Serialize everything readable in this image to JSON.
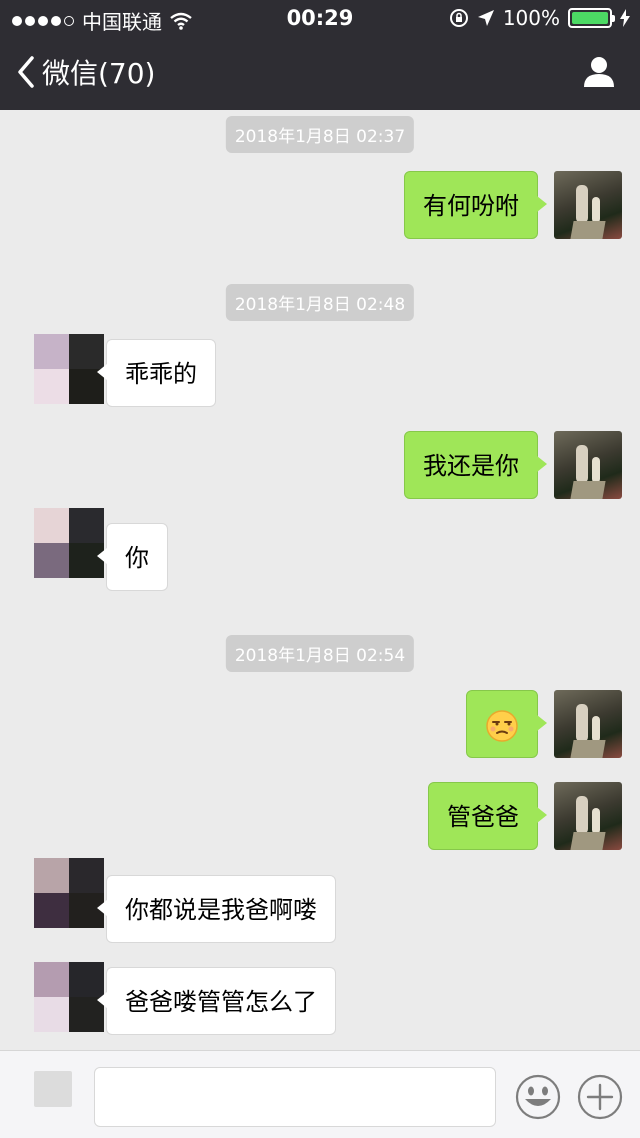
{
  "status": {
    "carrier": "中国联通",
    "time": "00:29",
    "battery": "100%",
    "signal_dots_filled": 4,
    "icons": [
      "wifi-icon",
      "orientation-lock-icon",
      "location-arrow-icon",
      "battery-icon",
      "charging-icon"
    ]
  },
  "nav": {
    "back_label": "微信(70)",
    "right_icon": "profile-icon"
  },
  "messages": [
    {
      "type": "timestamp",
      "text": "2018年1月8日 02:37"
    },
    {
      "type": "out",
      "text": "有何吩咐"
    },
    {
      "type": "timestamp",
      "text": "2018年1月8日 02:48"
    },
    {
      "type": "in",
      "text": "乖乖的"
    },
    {
      "type": "out",
      "text": "我还是你"
    },
    {
      "type": "in",
      "text": "你"
    },
    {
      "type": "timestamp",
      "text": "2018年1月8日 02:54"
    },
    {
      "type": "out",
      "emoji": "unamused-face-icon",
      "text": "😒"
    },
    {
      "type": "out",
      "text": "管爸爸"
    },
    {
      "type": "in",
      "text": "你都说是我爸啊喽"
    },
    {
      "type": "in",
      "text": "爸爸喽管管怎么了"
    }
  ],
  "input": {
    "placeholder": "",
    "icons": [
      "voice-icon",
      "emoji-icon",
      "plus-icon"
    ]
  },
  "colors": {
    "nav_bg": "#2e2d33",
    "chat_bg": "#ebebeb",
    "outgoing_bubble": "#9fe658",
    "incoming_bubble": "#ffffff",
    "timestamp_bg": "#cecece"
  }
}
